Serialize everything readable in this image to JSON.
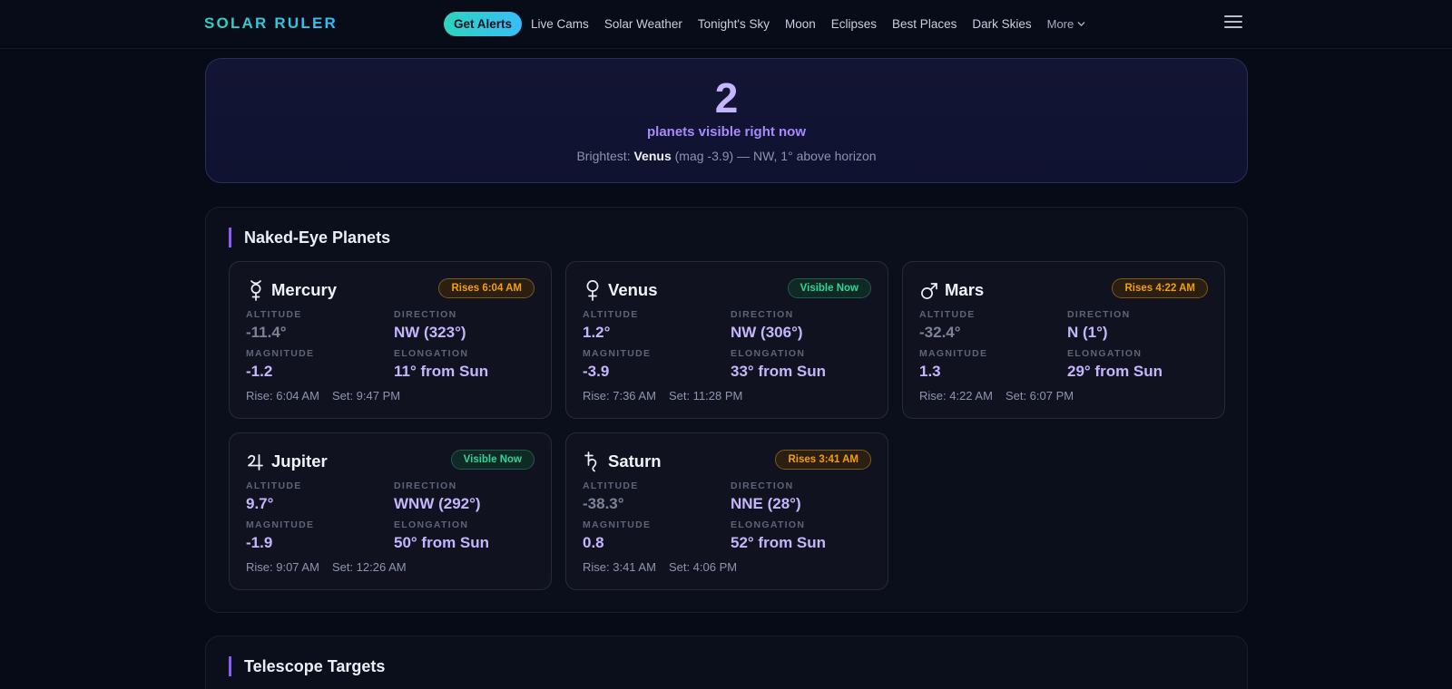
{
  "brand": "SOLAR RULER",
  "nav": {
    "cta": "Get Alerts",
    "links": [
      "Live Cams",
      "Solar Weather",
      "Tonight's Sky",
      "Moon",
      "Eclipses",
      "Best Places",
      "Dark Skies"
    ],
    "more": "More"
  },
  "hero": {
    "count": "2",
    "subtitle": "planets visible right now",
    "brightest_prefix": "Brightest:",
    "brightest_name": "Venus",
    "brightest_detail": "(mag -3.9) — NW, 1° above horizon"
  },
  "sections": {
    "planets_title": "Naked-Eye Planets",
    "telescope_title": "Telescope Targets"
  },
  "labels": {
    "altitude": "ALTITUDE",
    "direction": "DIRECTION",
    "magnitude": "MAGNITUDE",
    "elongation": "ELONGATION"
  },
  "planets": [
    {
      "symbol": "mercury-icon",
      "name": "Mercury",
      "badge": "Rises 6:04 AM",
      "status": "rise",
      "altitude": "-11.4°",
      "direction": "NW (323°)",
      "magnitude": "-1.2",
      "elongation": "11° from Sun",
      "rise": "Rise: 6:04 AM",
      "set": "Set: 9:47 PM"
    },
    {
      "symbol": "venus-icon",
      "name": "Venus",
      "badge": "Visible Now",
      "status": "visible",
      "altitude": "1.2°",
      "direction": "NW (306°)",
      "magnitude": "-3.9",
      "elongation": "33° from Sun",
      "rise": "Rise: 7:36 AM",
      "set": "Set: 11:28 PM"
    },
    {
      "symbol": "mars-icon",
      "name": "Mars",
      "badge": "Rises 4:22 AM",
      "status": "rise",
      "altitude": "-32.4°",
      "direction": "N (1°)",
      "magnitude": "1.3",
      "elongation": "29° from Sun",
      "rise": "Rise: 4:22 AM",
      "set": "Set: 6:07 PM"
    },
    {
      "symbol": "jupiter-icon",
      "name": "Jupiter",
      "badge": "Visible Now",
      "status": "visible",
      "altitude": "9.7°",
      "direction": "WNW (292°)",
      "magnitude": "-1.9",
      "elongation": "50° from Sun",
      "rise": "Rise: 9:07 AM",
      "set": "Set: 12:26 AM"
    },
    {
      "symbol": "saturn-icon",
      "name": "Saturn",
      "badge": "Rises 3:41 AM",
      "status": "rise",
      "altitude": "-38.3°",
      "direction": "NNE (28°)",
      "magnitude": "0.8",
      "elongation": "52° from Sun",
      "rise": "Rise: 3:41 AM",
      "set": "Set: 4:06 PM"
    }
  ],
  "colors": {
    "accent": "#2dd4bf",
    "violet": "#a78bfa",
    "value": "#c4b5fd",
    "rise_badge": "#f59e0b",
    "visible_badge": "#34d399"
  }
}
